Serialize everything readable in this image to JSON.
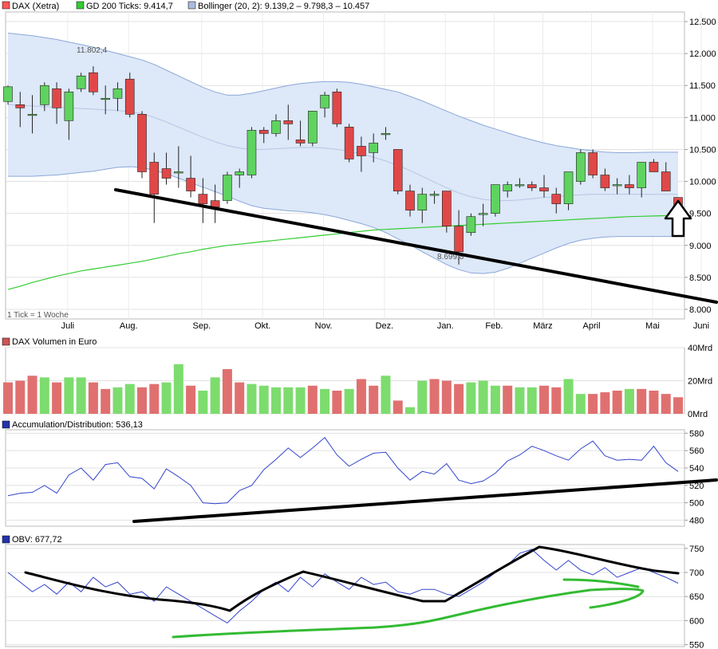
{
  "colors": {
    "up": "#5fd35f",
    "down": "#e04848",
    "volume_up": "#7ddc6e",
    "volume_down": "#e07070",
    "gd200": "#33cc33",
    "bollinger_fill": "#dde8f8",
    "bollinger_line": "#8aa8d8",
    "ad_line": "#3344cc",
    "obv_line": "#3344cc",
    "annotation_black": "#000000",
    "annotation_green": "#33bb33"
  },
  "legends": {
    "price": [
      {
        "label": "DAX (Xetra)",
        "color": "#ff5555"
      },
      {
        "label": "GD 200 Ticks: 9.414,7",
        "color": "#33cc33"
      },
      {
        "label": "Bollinger (20, 2): 9.139,2 – 9.798,3 – 10.457",
        "color": "#aabbdd"
      }
    ],
    "volume": {
      "label": "DAX Volumen in Euro",
      "color": "#cc5555"
    },
    "ad": {
      "label": "Accumulation/Distribution: 536,13",
      "color": "#2233aa"
    },
    "obv": {
      "label": "OBV: 677,72",
      "color": "#2233aa"
    }
  },
  "annotations": {
    "high_label": "11.802,4",
    "low_label": "8.699,8",
    "tick_note": "1 Tick = 1 Woche"
  },
  "months": [
    "Juli",
    "Aug.",
    "Sep.",
    "Okt.",
    "Nov.",
    "Dez.",
    "Jan.",
    "Feb.",
    "März",
    "April",
    "Mai",
    "Juni"
  ],
  "chart_data": [
    {
      "type": "candlestick",
      "title": "DAX (Xetra)",
      "ylim": [
        7850,
        12650
      ],
      "y_ticks": [
        "12.500",
        "12.000",
        "11.500",
        "11.000",
        "10.500",
        "10.000",
        "9.500",
        "9.000",
        "8.500",
        "8.000"
      ],
      "y_tick_values": [
        12500,
        12000,
        11500,
        11000,
        10500,
        10000,
        9500,
        9000,
        8500,
        8000
      ],
      "candles": [
        [
          11250,
          11500,
          11200,
          11480
        ],
        [
          11200,
          11400,
          10850,
          11150
        ],
        [
          11050,
          11350,
          10750,
          11050
        ],
        [
          11200,
          11550,
          11100,
          11500
        ],
        [
          11450,
          11550,
          10900,
          11150
        ],
        [
          10950,
          11450,
          10650,
          11400
        ],
        [
          11450,
          11700,
          11400,
          11650
        ],
        [
          11700,
          11800,
          11350,
          11400
        ],
        [
          11300,
          11500,
          11050,
          11300
        ],
        [
          11300,
          11550,
          11100,
          11450
        ],
        [
          11600,
          11700,
          11000,
          11050
        ],
        [
          11050,
          11100,
          10050,
          10150
        ],
        [
          10300,
          10450,
          9350,
          9800
        ],
        [
          10200,
          10450,
          9950,
          10050
        ],
        [
          10150,
          10550,
          9900,
          10150
        ],
        [
          10050,
          10400,
          9750,
          9850
        ],
        [
          9800,
          10050,
          9350,
          9650
        ],
        [
          9700,
          9950,
          9350,
          9600
        ],
        [
          9700,
          10150,
          9650,
          10100
        ],
        [
          10100,
          10200,
          9900,
          10150
        ],
        [
          10100,
          10850,
          10050,
          10800
        ],
        [
          10800,
          10850,
          10600,
          10750
        ],
        [
          10750,
          11050,
          10700,
          10950
        ],
        [
          10950,
          11200,
          10650,
          10900
        ],
        [
          10650,
          10950,
          10550,
          10600
        ],
        [
          10600,
          11100,
          10550,
          11100
        ],
        [
          11150,
          11400,
          11000,
          11350
        ],
        [
          11400,
          11450,
          10850,
          10900
        ],
        [
          10850,
          10900,
          10300,
          10350
        ],
        [
          10550,
          10700,
          10150,
          10400
        ],
        [
          10450,
          10750,
          10300,
          10600
        ],
        [
          10750,
          10850,
          10650,
          10750
        ],
        [
          10500,
          10500,
          9800,
          9850
        ],
        [
          9850,
          9950,
          9450,
          9550
        ],
        [
          9550,
          9900,
          9350,
          9800
        ],
        [
          9800,
          9850,
          9650,
          9800
        ],
        [
          9850,
          9850,
          9200,
          9300
        ],
        [
          9300,
          9550,
          8700,
          8900
        ],
        [
          9200,
          9500,
          9150,
          9450
        ],
        [
          9500,
          9650,
          9300,
          9500
        ],
        [
          9500,
          9950,
          9450,
          9950
        ],
        [
          9850,
          10000,
          9750,
          9950
        ],
        [
          9950,
          10050,
          9900,
          9950
        ],
        [
          9950,
          10000,
          9850,
          9900
        ],
        [
          9900,
          10100,
          9750,
          9850
        ],
        [
          9800,
          9900,
          9500,
          9650
        ],
        [
          9650,
          10150,
          9550,
          10150
        ],
        [
          10000,
          10500,
          9950,
          10450
        ],
        [
          10450,
          10500,
          10050,
          10100
        ],
        [
          10100,
          10200,
          9850,
          9900
        ],
        [
          9950,
          10050,
          9800,
          9950
        ],
        [
          9950,
          10100,
          9800,
          9900
        ],
        [
          9900,
          10300,
          9750,
          10300
        ],
        [
          10300,
          10350,
          10150,
          10150
        ],
        [
          10150,
          10300,
          9850,
          9850
        ],
        [
          9750,
          9750,
          9450,
          9500
        ]
      ],
      "series": [
        {
          "name": "GD 200 Ticks",
          "values": [
            8310,
            8360,
            8420,
            8470,
            8520,
            8560,
            8600,
            8630,
            8660,
            8690,
            8720,
            8750,
            8790,
            8830,
            8870,
            8900,
            8940,
            8970,
            9000,
            9020,
            9040,
            9060,
            9080,
            9100,
            9120,
            9140,
            9160,
            9180,
            9200,
            9220,
            9240,
            9250,
            9260,
            9270,
            9280,
            9290,
            9300,
            9310,
            9320,
            9330,
            9340,
            9350,
            9360,
            9370,
            9380,
            9390,
            9400,
            9410,
            9420,
            9430,
            9440,
            9450,
            9455,
            9460,
            9465,
            9470
          ]
        },
        {
          "name": "Bollinger upper",
          "values": [
            12320,
            12300,
            12280,
            12250,
            12220,
            12180,
            12140,
            12100,
            12050,
            12000,
            11950,
            11900,
            11830,
            11740,
            11650,
            11560,
            11470,
            11400,
            11350,
            11350,
            11380,
            11420,
            11460,
            11500,
            11530,
            11550,
            11560,
            11560,
            11550,
            11520,
            11480,
            11440,
            11400,
            11330,
            11260,
            11180,
            11100,
            11020,
            10950,
            10880,
            10820,
            10760,
            10700,
            10650,
            10600,
            10560,
            10530,
            10500,
            10480,
            10460,
            10450,
            10450,
            10455,
            10457,
            10457,
            10457
          ]
        },
        {
          "name": "Bollinger middle",
          "values": [
            11200,
            11190,
            11180,
            11170,
            11160,
            11150,
            11140,
            11130,
            11120,
            11110,
            11090,
            11060,
            11000,
            10930,
            10850,
            10770,
            10690,
            10620,
            10560,
            10520,
            10500,
            10500,
            10510,
            10520,
            10530,
            10530,
            10520,
            10500,
            10470,
            10430,
            10380,
            10320,
            10250,
            10170,
            10080,
            9990,
            9900,
            9820,
            9760,
            9720,
            9700,
            9700,
            9710,
            9730,
            9750,
            9760,
            9780,
            9790,
            9800,
            9800,
            9800,
            9800,
            9799,
            9798,
            9798,
            9798
          ]
        },
        {
          "name": "Bollinger lower",
          "values": [
            10080,
            10080,
            10080,
            10090,
            10100,
            10120,
            10140,
            10160,
            10190,
            10220,
            10230,
            10220,
            10170,
            10120,
            10050,
            9980,
            9910,
            9840,
            9770,
            9690,
            9620,
            9580,
            9560,
            9540,
            9530,
            9510,
            9480,
            9440,
            9390,
            9340,
            9280,
            9200,
            9100,
            9010,
            8900,
            8800,
            8700,
            8620,
            8570,
            8560,
            8580,
            8640,
            8720,
            8800,
            8880,
            8960,
            9030,
            9080,
            9110,
            9130,
            9139,
            9139,
            9139,
            9139,
            9139,
            9139
          ]
        }
      ]
    },
    {
      "type": "bar",
      "title": "DAX Volumen in Euro",
      "ylim": [
        0,
        40
      ],
      "y_ticks": [
        "40Mrd",
        "20Mrd",
        "0Mrd"
      ],
      "y_tick_values": [
        40,
        20,
        0
      ],
      "values": [
        19,
        20,
        23,
        22,
        19,
        22,
        22,
        19,
        15,
        16,
        18,
        16,
        18,
        19,
        30,
        17,
        14,
        22,
        27,
        19,
        18,
        17,
        16,
        16,
        16,
        17,
        15,
        14,
        15,
        21,
        17,
        23,
        8,
        4,
        20,
        21,
        20,
        18,
        19,
        20,
        17,
        17,
        16,
        16,
        17,
        16,
        21,
        12,
        12,
        13,
        14,
        15,
        15,
        14,
        12,
        10
      ],
      "up": [
        false,
        false,
        false,
        true,
        false,
        true,
        true,
        false,
        false,
        true,
        true,
        false,
        false,
        true,
        true,
        false,
        true,
        true,
        false,
        false,
        true,
        true,
        true,
        true,
        true,
        false,
        true,
        false,
        true,
        false,
        false,
        true,
        false,
        true,
        true,
        false,
        false,
        false,
        true,
        true,
        true,
        false,
        true,
        true,
        false,
        false,
        true,
        true,
        false,
        false,
        false,
        true,
        false,
        false,
        false,
        false
      ]
    },
    {
      "type": "line",
      "title": "Accumulation/Distribution",
      "ylim": [
        473,
        584
      ],
      "y_ticks": [
        "580",
        "560",
        "540",
        "520",
        "500",
        "480"
      ],
      "y_tick_values": [
        580,
        560,
        540,
        520,
        500,
        480
      ],
      "values": [
        508,
        511,
        512,
        520,
        511,
        532,
        540,
        526,
        544,
        546,
        530,
        528,
        516,
        539,
        530,
        520,
        500,
        499,
        500,
        514,
        520,
        538,
        550,
        563,
        552,
        563,
        575,
        555,
        542,
        550,
        557,
        558,
        540,
        526,
        536,
        533,
        545,
        526,
        522,
        525,
        534,
        548,
        555,
        565,
        560,
        554,
        549,
        562,
        571,
        554,
        549,
        550,
        549,
        565,
        546,
        536
      ]
    },
    {
      "type": "line",
      "title": "OBV",
      "ylim": [
        546,
        758
      ],
      "y_ticks": [
        "750",
        "700",
        "650",
        "600",
        "550"
      ],
      "y_tick_values": [
        750,
        700,
        650,
        600,
        550
      ],
      "values": [
        700,
        680,
        660,
        675,
        655,
        680,
        660,
        690,
        670,
        680,
        655,
        660,
        640,
        670,
        655,
        640,
        625,
        610,
        595,
        620,
        640,
        665,
        680,
        660,
        690,
        670,
        697,
        680,
        665,
        690,
        675,
        680,
        660,
        655,
        665,
        665,
        655,
        650,
        665,
        680,
        700,
        715,
        740,
        748,
        725,
        705,
        725,
        705,
        695,
        710,
        690,
        700,
        710,
        700,
        690,
        677.72
      ]
    }
  ]
}
